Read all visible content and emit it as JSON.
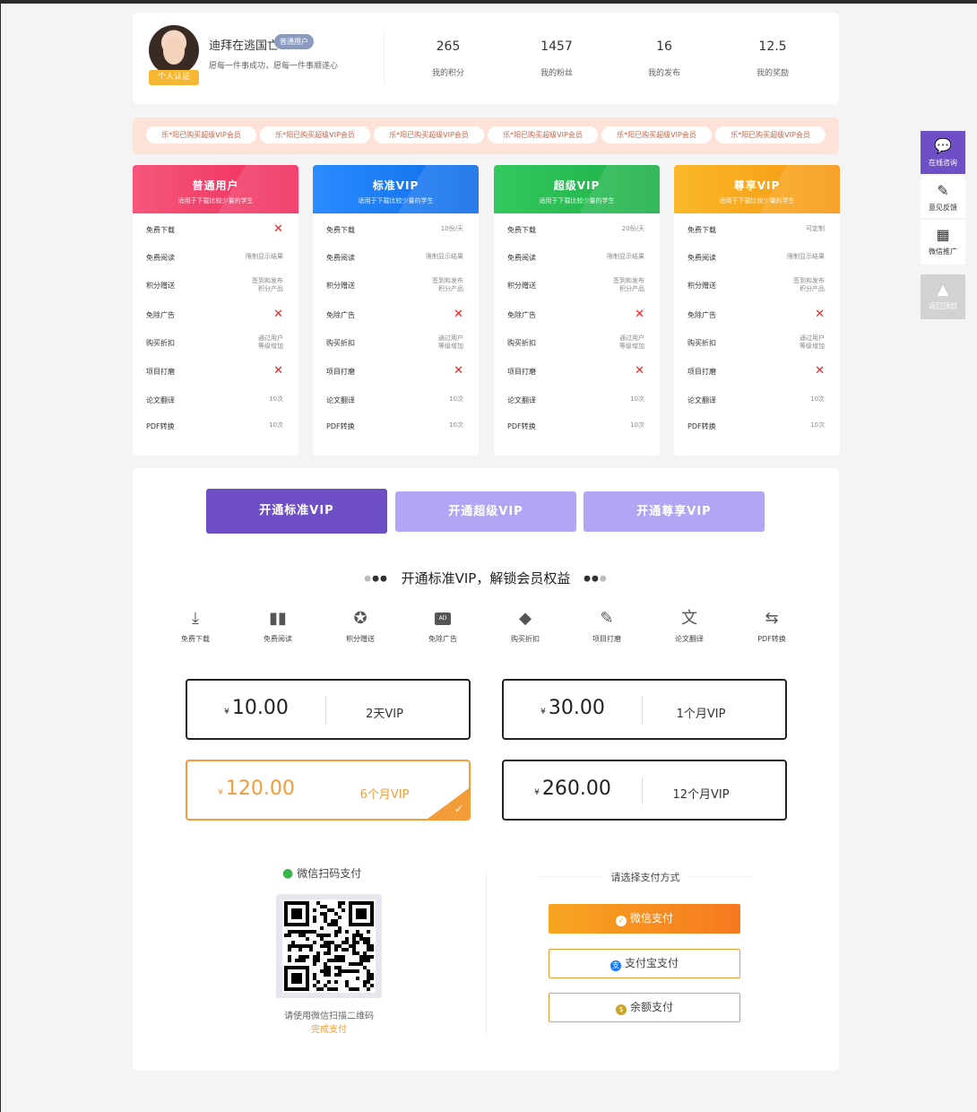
{
  "profile": {
    "username": "迪拜在逃国亡",
    "user_badge": "普通用户",
    "cert_badge": "个人认证",
    "motto": "愿每一件事成功，愿每一件事顺遂心",
    "stats": [
      {
        "value": "265",
        "label": "我的积分"
      },
      {
        "value": "1457",
        "label": "我的粉丝"
      },
      {
        "value": "16",
        "label": "我的发布"
      },
      {
        "value": "12.5",
        "label": "我的奖励"
      }
    ]
  },
  "marquee": [
    "乐*阳已购买超级VIP会员",
    "乐*阳已购买超级VIP会员",
    "乐*阳已购买超级VIP会员",
    "乐*阳已购买超级VIP会员",
    "乐*阳已购买超级VIP会员",
    "乐*阳已购买超级VIP会员"
  ],
  "plans": [
    {
      "title": "普通用户",
      "subtitle": "适用于下载比较少量的学生",
      "color_from": "#f5577b",
      "color_to": "#ef2a5a",
      "rows": [
        {
          "k": "免费下载",
          "x": true
        },
        {
          "k": "免费阅读",
          "v": "限制显示结果"
        },
        {
          "k": "积分赠送",
          "v1": "签到和发布",
          "v2": "积分产品"
        },
        {
          "k": "免除广告",
          "x": true
        },
        {
          "k": "购买折扣",
          "v1": "通过用户",
          "v2": "等级增加"
        },
        {
          "k": "项目打磨",
          "x": true
        },
        {
          "k": "论文翻译",
          "v": "10次"
        },
        {
          "k": "PDF转换",
          "v": "10次"
        }
      ]
    },
    {
      "title": "标准VIP",
      "subtitle": "适用于下载比较少量的学生",
      "color_from": "#2a8cff",
      "color_to": "#0b6ae6",
      "rows": [
        {
          "k": "免费下载",
          "v": "10份/天"
        },
        {
          "k": "免费阅读",
          "v": "限制显示结果"
        },
        {
          "k": "积分赠送",
          "v1": "签到和发布",
          "v2": "积分产品"
        },
        {
          "k": "免除广告",
          "x": true
        },
        {
          "k": "购买折扣",
          "v1": "通过用户",
          "v2": "等级增加"
        },
        {
          "k": "项目打磨",
          "x": true
        },
        {
          "k": "论文翻译",
          "v": "10次"
        },
        {
          "k": "PDF转换",
          "v": "10次"
        }
      ]
    },
    {
      "title": "超级VIP",
      "subtitle": "适用于下载比较少量的学生",
      "color_from": "#34c95e",
      "color_to": "#1aae45",
      "rows": [
        {
          "k": "免费下载",
          "v": "20份/天"
        },
        {
          "k": "免费阅读",
          "v": "限制显示结果"
        },
        {
          "k": "积分赠送",
          "v1": "签到和发布",
          "v2": "积分产品"
        },
        {
          "k": "免除广告",
          "x": true
        },
        {
          "k": "购买折扣",
          "v1": "通过用户",
          "v2": "等级增加"
        },
        {
          "k": "项目打磨",
          "x": true
        },
        {
          "k": "论文翻译",
          "v": "10次"
        },
        {
          "k": "PDF转换",
          "v": "10次"
        }
      ]
    },
    {
      "title": "尊享VIP",
      "subtitle": "适用于下载比较少量的学生",
      "color_from": "#fbb82a",
      "color_to": "#f5960f",
      "rows": [
        {
          "k": "免费下载",
          "v": "可定制"
        },
        {
          "k": "免费阅读",
          "v": "限制显示结果"
        },
        {
          "k": "积分赠送",
          "v1": "签到和发布",
          "v2": "积分产品"
        },
        {
          "k": "免除广告",
          "x": true
        },
        {
          "k": "购买折扣",
          "v1": "通过用户",
          "v2": "等级增加"
        },
        {
          "k": "项目打磨",
          "x": true
        },
        {
          "k": "论文翻译",
          "v": "10次"
        },
        {
          "k": "PDF转换",
          "v": "10次"
        }
      ]
    }
  ],
  "tabs": [
    "开通标准VIP",
    "开通超级VIP",
    "开通尊享VIP"
  ],
  "section_title": "开通标准VIP，解锁会员权益",
  "features": [
    {
      "label": "免费下载",
      "icon": "download-icon"
    },
    {
      "label": "免费阅读",
      "icon": "book-icon"
    },
    {
      "label": "积分赠送",
      "icon": "badge-icon"
    },
    {
      "label": "免除广告",
      "icon": "ad-icon"
    },
    {
      "label": "购买折扣",
      "icon": "tag-icon"
    },
    {
      "label": "项目打磨",
      "icon": "edit-icon"
    },
    {
      "label": "论文翻译",
      "icon": "translate-icon"
    },
    {
      "label": "PDF转换",
      "icon": "swap-icon"
    }
  ],
  "prices": [
    {
      "currency": "¥",
      "amount": "10.00",
      "duration": "2天VIP",
      "selected": false
    },
    {
      "currency": "¥",
      "amount": "30.00",
      "duration": "1个月VIP",
      "selected": false
    },
    {
      "currency": "¥",
      "amount": "120.00",
      "duration": "6个月VIP",
      "selected": true
    },
    {
      "currency": "¥",
      "amount": "260.00",
      "duration": "12个月VIP",
      "selected": false
    }
  ],
  "payment": {
    "wechat_title": "微信扫码支付",
    "qr_hint": "请使用微信扫描二维码",
    "qr_done": "完成支付",
    "choose_title": "请选择支付方式",
    "methods": [
      "微信支付",
      "支付宝支付",
      "余额支付"
    ]
  },
  "sidebar": [
    {
      "label": "在线咨询",
      "icon": "chat-icon"
    },
    {
      "label": "意见反馈",
      "icon": "feedback-icon"
    },
    {
      "label": "微信推广",
      "icon": "qrcode-icon"
    },
    {
      "label": "返回顶部",
      "icon": "arrow-up-icon"
    }
  ],
  "colors": {
    "accent": "#6e4fc6",
    "accent_light": "#b1a6f4",
    "orange": "#f39c3a"
  }
}
